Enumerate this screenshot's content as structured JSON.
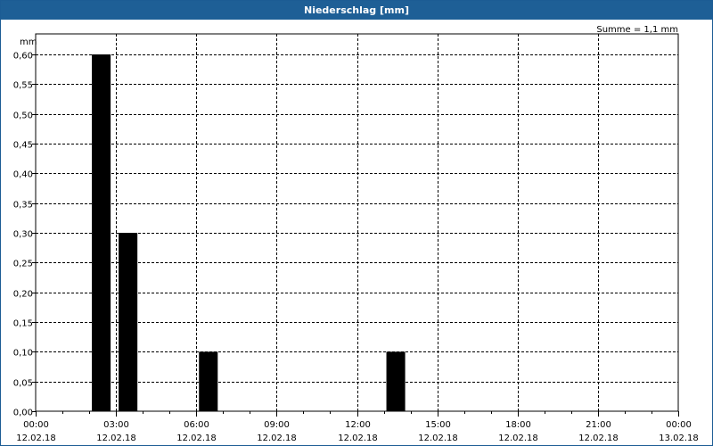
{
  "window": {
    "title": "Niederschlag [mm]"
  },
  "chart_data": {
    "type": "bar",
    "title": "Niederschlag [mm]",
    "ylabel": "mm",
    "summary": "Summe = 1,1 mm",
    "ylim": [
      0,
      0.6
    ],
    "xlim_hours": [
      0,
      24
    ],
    "y_ticks": [
      "0,00",
      "0,05",
      "0,10",
      "0,15",
      "0,20",
      "0,25",
      "0,30",
      "0,35",
      "0,40",
      "0,45",
      "0,50",
      "0,55",
      "0,60"
    ],
    "x_ticks": [
      {
        "hour": 0,
        "time": "00:00",
        "date": "12.02.18"
      },
      {
        "hour": 3,
        "time": "03:00",
        "date": "12.02.18"
      },
      {
        "hour": 6,
        "time": "06:00",
        "date": "12.02.18"
      },
      {
        "hour": 9,
        "time": "09:00",
        "date": "12.02.18"
      },
      {
        "hour": 12,
        "time": "12:00",
        "date": "12.02.18"
      },
      {
        "hour": 15,
        "time": "15:00",
        "date": "12.02.18"
      },
      {
        "hour": 18,
        "time": "18:00",
        "date": "12.02.18"
      },
      {
        "hour": 21,
        "time": "21:00",
        "date": "12.02.18"
      },
      {
        "hour": 24,
        "time": "00:00",
        "date": "13.02.18"
      }
    ],
    "bars": [
      {
        "start": "02:00",
        "end": "03:00",
        "value": 0.6
      },
      {
        "start": "03:00",
        "end": "04:00",
        "value": 0.3
      },
      {
        "start": "06:00",
        "end": "07:00",
        "value": 0.1
      },
      {
        "start": "13:00",
        "end": "14:00",
        "value": 0.1
      }
    ],
    "bar_color": "#000000",
    "grid": true
  }
}
